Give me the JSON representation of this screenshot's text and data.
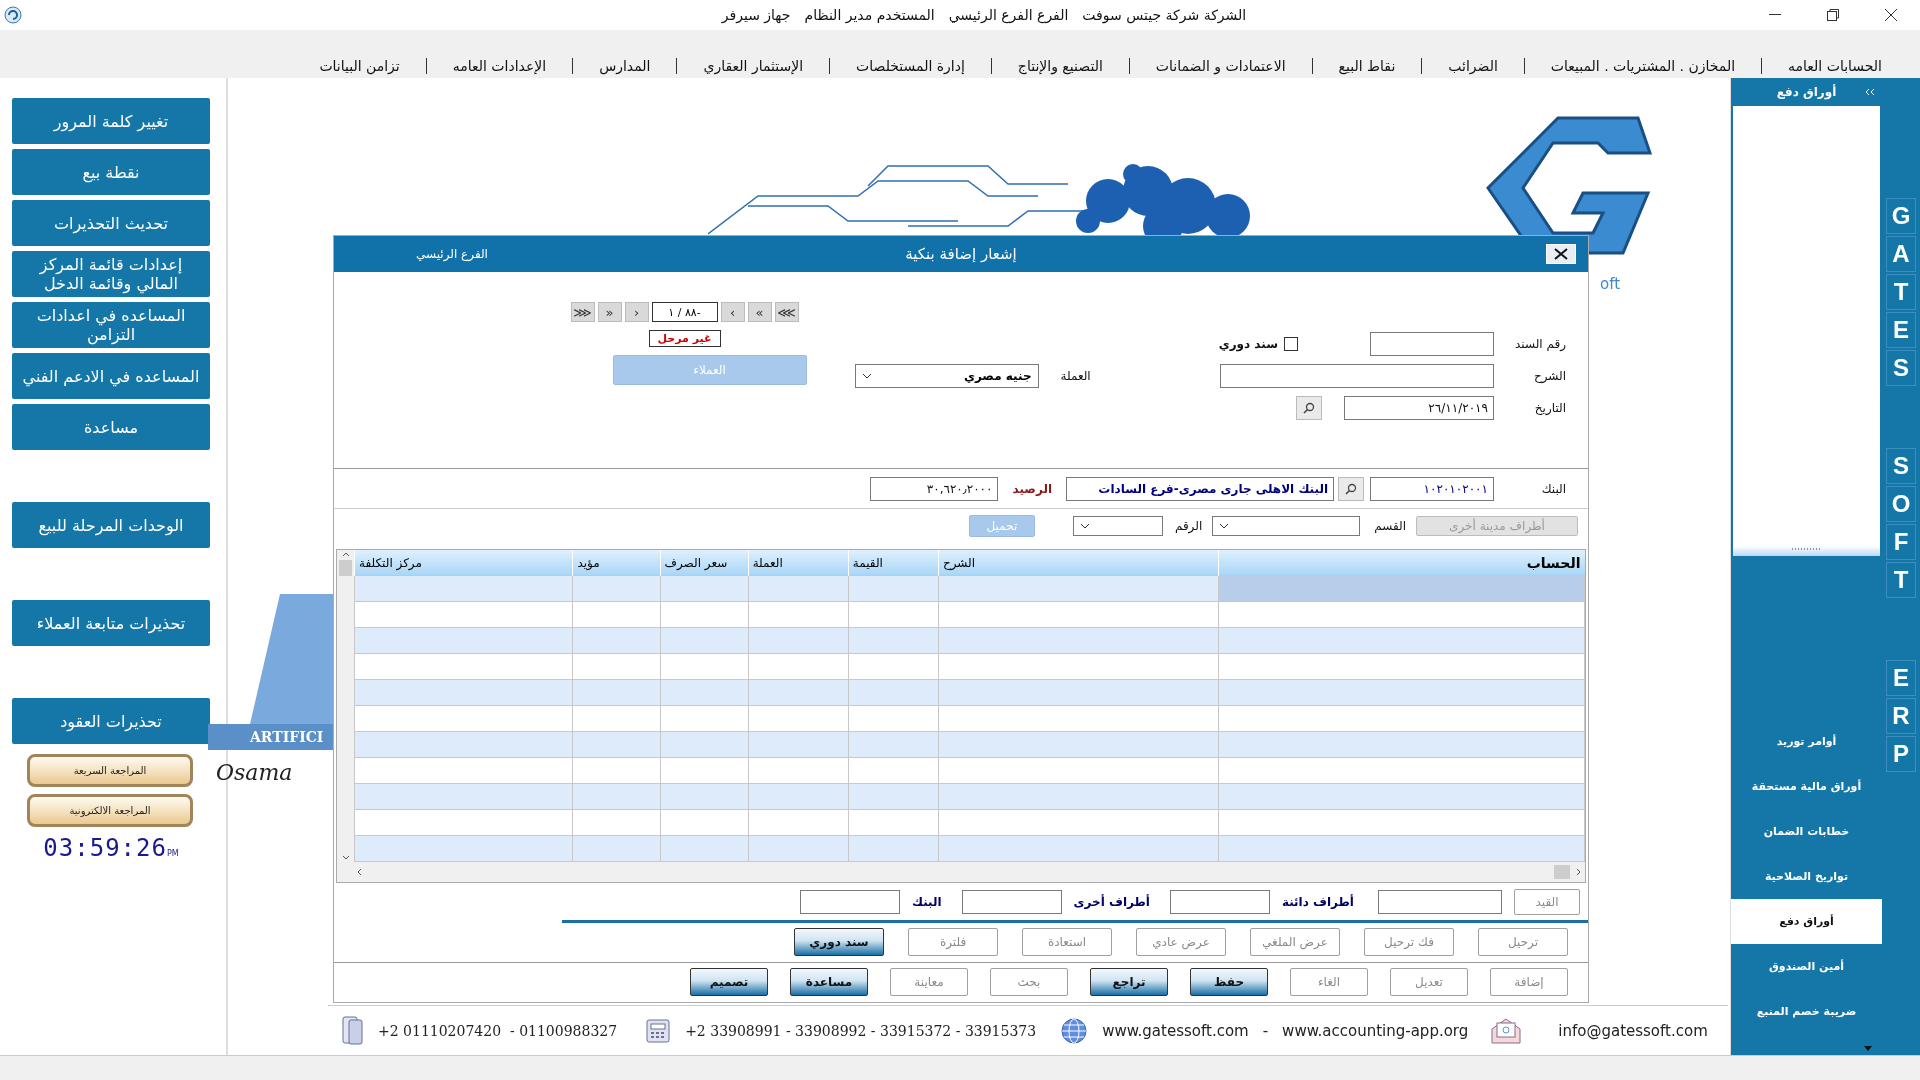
{
  "title_bar": {
    "segments": [
      "الشركة شركة جيتس سوفت",
      "الفرع الفرع الرئيسي",
      "المستخدم مدير النظام",
      "جهاز سيرفر"
    ]
  },
  "menu": [
    "الحسابات العامه",
    "المخازن . المشتريات . المبيعات",
    "الضرائب",
    "نقاط البيع",
    "الاعتمادات و الضمانات",
    "التصنيع والإنتاج",
    "إدارة المستخلصات",
    "الإستثمار العقاري",
    "المدارس",
    "الإعدادات العامه",
    "تزامن البيانات"
  ],
  "sidebar": {
    "groups": [
      [
        "تغيير كلمة المرور",
        "نقطة بيع",
        "تحديث التحذيرات",
        "إعدادات قائمة المركز المالي وقائمة الدخل",
        "المساعده في اعدادات التزامن",
        "المساعده في اﻻدعم الفني",
        "مساعدة"
      ],
      [
        "الوحدات المرحلة للبيع"
      ],
      [
        "تحذيرات متابعة العملاء"
      ],
      [
        "تحذيرات العقود"
      ]
    ],
    "review_buttons": [
      "المراجعة السريعة",
      "المراجعة الالكترونية"
    ],
    "clock": {
      "time": "03:59:26",
      "period": "PM"
    }
  },
  "background": {
    "brand_fragment": "oft",
    "artificial_fragment": "ARTIFICI",
    "signature_fragment": "Osama"
  },
  "dialog": {
    "title": "إشعار إضافة بنكية",
    "branch": "الفرع الرئيسي",
    "navigator": {
      "right": [
        "⋙",
        "»",
        "›"
      ],
      "record": "٨٨ / ١-",
      "left": [
        "‹",
        "«",
        "⋘"
      ]
    },
    "status": "غير مرحل",
    "voucher_no": {
      "label": "رقم السند"
    },
    "periodic": {
      "label": "سند دوري",
      "checked": false
    },
    "description": {
      "label": "الشرح"
    },
    "currency": {
      "label": "العملة",
      "value": "جنيه مصري"
    },
    "customers_button": {
      "label": "العملاء",
      "disabled": true
    },
    "date": {
      "label": "التاريخ",
      "value": "٢٦/١١/٢٠١٩"
    },
    "bank": {
      "label": "البنك",
      "code": "١٠٢٠١٠٢٠٠١",
      "name": "البنك الاهلى جارى مصرى-فرع السادات",
      "balance_label": "الرصيد",
      "balance": "٣٠,٦٢٠٫٢٠٠٠"
    },
    "filter": {
      "other_button": {
        "label": "أطراف مدينة أخرى",
        "disabled": true
      },
      "section_label": "القسم",
      "number_label": "الرقم",
      "load_button": {
        "label": "تحميل",
        "disabled": true
      }
    },
    "table": {
      "columns": [
        "الحساب",
        "الشرح",
        "القيمة",
        "العملة",
        "سعر الصرف",
        "مؤيد",
        "مركز التكلفة"
      ],
      "rows": [
        {
          "selected": true
        },
        {
          "selected": false
        },
        {
          "selected": false
        },
        {
          "selected": false
        },
        {
          "selected": false
        },
        {
          "selected": false
        },
        {
          "selected": false
        },
        {
          "selected": false
        },
        {
          "selected": false
        },
        {
          "selected": false
        },
        {
          "selected": false
        }
      ]
    },
    "totals": {
      "entry_button": {
        "label": "القيد",
        "disabled": true
      },
      "fields": [
        {
          "label": "أطراف دائنة"
        },
        {
          "label": "أطراف أخرى"
        },
        {
          "label": "البنك"
        }
      ]
    },
    "action_rows": [
      [
        {
          "label": "ترحيل",
          "disabled": true
        },
        {
          "label": "فك ترحيل",
          "disabled": true
        },
        {
          "label": "عرض الملغي",
          "disabled": true
        },
        {
          "label": "عرض عادي",
          "disabled": true
        },
        {
          "label": "استعادة",
          "disabled": true
        },
        {
          "label": "فلترة",
          "disabled": true
        },
        {
          "label": "سند دوري",
          "disabled": false
        }
      ],
      [
        {
          "label": "إضافة",
          "disabled": true
        },
        {
          "label": "تعديل",
          "disabled": true
        },
        {
          "label": "الغاء",
          "disabled": true
        },
        {
          "label": "حفظ",
          "disabled": false
        },
        {
          "label": "تراجع",
          "disabled": false
        },
        {
          "label": "بحث",
          "disabled": true
        },
        {
          "label": "معاينة",
          "disabled": true
        },
        {
          "label": "مساعدة",
          "disabled": false
        },
        {
          "label": "تصميم",
          "disabled": false
        }
      ]
    ]
  },
  "footer": {
    "mobiles": "+2 01110207420  - 01100988327",
    "landlines": "+2 33908991 - 33908992 - 33915372 - 33915373",
    "website": "www.gatessoft.com",
    "separator": "-",
    "website_2": "www.accounting-app.org",
    "email": "info@gatessoft.com"
  },
  "right_panel": {
    "title": "أوراق دفع",
    "items": [
      {
        "label": "أوامر توريد",
        "selected": false
      },
      {
        "label": "أوراق مالية مستحقة",
        "selected": false
      },
      {
        "label": "خطابات الضمان",
        "selected": false
      },
      {
        "label": "تواريخ الصلاحية",
        "selected": false
      },
      {
        "label": "أوراق دفع",
        "selected": true
      },
      {
        "label": "أمين الصندوق",
        "selected": false
      },
      {
        "label": "ضريبة خصم المنبع",
        "selected": false
      }
    ]
  },
  "brand_strip": {
    "words": [
      "GATES",
      "SOFT",
      "ERP"
    ]
  }
}
